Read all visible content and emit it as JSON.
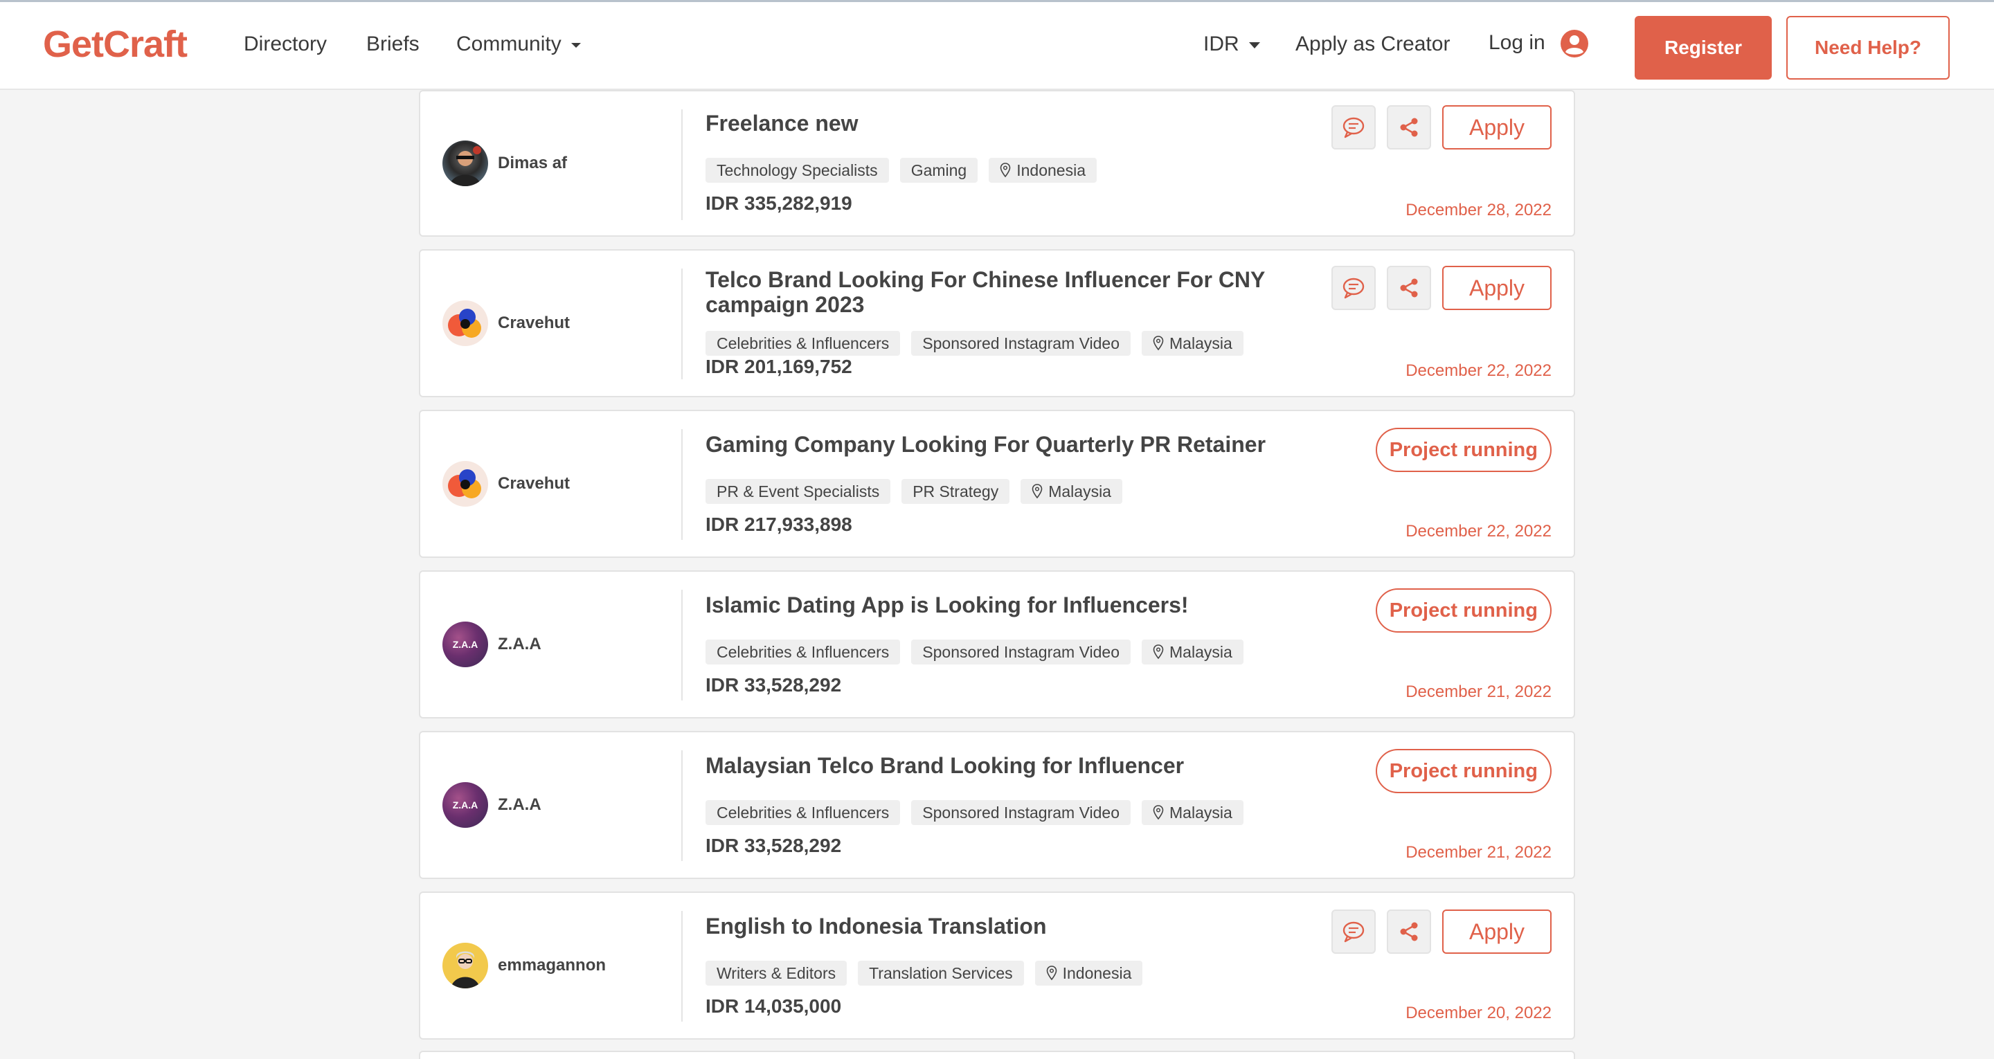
{
  "header": {
    "logo": "GetCraft",
    "nav": {
      "directory": "Directory",
      "briefs": "Briefs",
      "community": "Community"
    },
    "currency": "IDR",
    "apply_creator": "Apply as Creator",
    "login": "Log in",
    "register": "Register",
    "help": "Need Help?"
  },
  "colors": {
    "accent": "#e0614a"
  },
  "cards": [
    {
      "author": "Dimas af",
      "title": "Freelance new",
      "tags": [
        "Technology Specialists",
        "Gaming"
      ],
      "location": "Indonesia",
      "price": "IDR 335,282,919",
      "date": "December 28, 2022",
      "status": "apply",
      "apply_label": "Apply"
    },
    {
      "author": "Cravehut",
      "title": "Telco Brand Looking For Chinese Influencer For CNY campaign 2023",
      "tags": [
        "Celebrities & Influencers",
        "Sponsored Instagram Video"
      ],
      "location": "Malaysia",
      "price": "IDR 201,169,752",
      "date": "December 22, 2022",
      "status": "apply",
      "apply_label": "Apply"
    },
    {
      "author": "Cravehut",
      "title": "Gaming Company Looking For Quarterly PR Retainer",
      "tags": [
        "PR & Event Specialists",
        "PR Strategy"
      ],
      "location": "Malaysia",
      "price": "IDR 217,933,898",
      "date": "December 22, 2022",
      "status": "running",
      "running_label": "Project running"
    },
    {
      "author": "Z.A.A",
      "avatar_text": "Z.A.A",
      "title": "Islamic Dating App is Looking for Influencers!",
      "tags": [
        "Celebrities & Influencers",
        "Sponsored Instagram Video"
      ],
      "location": "Malaysia",
      "price": "IDR 33,528,292",
      "date": "December 21, 2022",
      "status": "running",
      "running_label": "Project running"
    },
    {
      "author": "Z.A.A",
      "avatar_text": "Z.A.A",
      "title": "Malaysian Telco Brand Looking for Influencer",
      "tags": [
        "Celebrities & Influencers",
        "Sponsored Instagram Video"
      ],
      "location": "Malaysia",
      "price": "IDR 33,528,292",
      "date": "December 21, 2022",
      "status": "running",
      "running_label": "Project running"
    },
    {
      "author": "emmagannon",
      "title": "English to Indonesia Translation",
      "tags": [
        "Writers & Editors",
        "Translation Services"
      ],
      "location": "Indonesia",
      "price": "IDR 14,035,000",
      "date": "December 20, 2022",
      "status": "apply",
      "apply_label": "Apply"
    }
  ]
}
